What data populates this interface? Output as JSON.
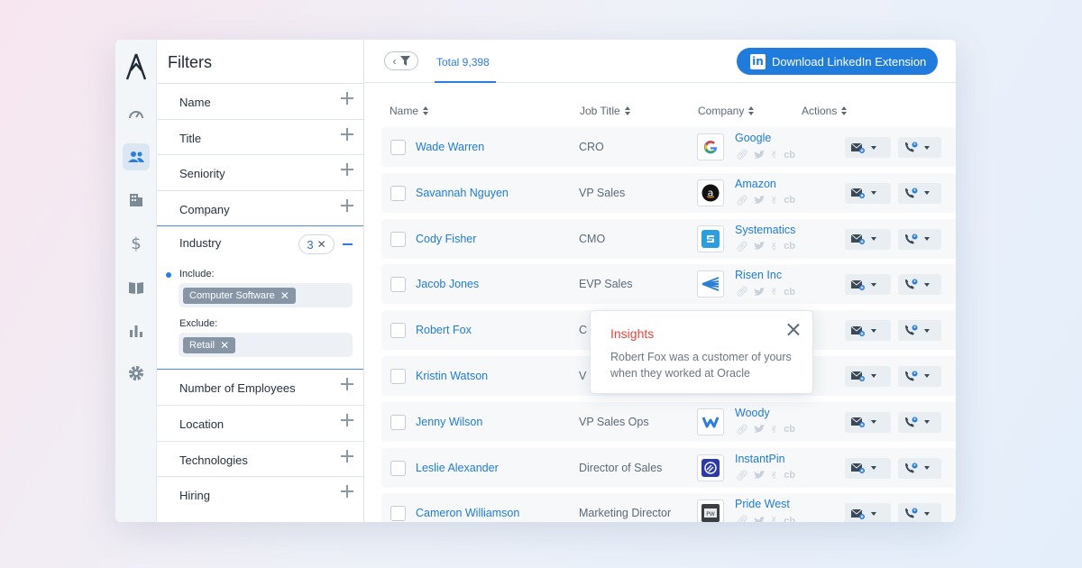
{
  "filters": {
    "title": "Filters",
    "items_top": [
      "Name",
      "Title",
      "Seniority",
      "Company"
    ],
    "industry": {
      "label": "Industry",
      "count": "3",
      "include_label": "Include:",
      "include_tag": "Computer Software",
      "exclude_label": "Exclude:",
      "exclude_tag": "Retail"
    },
    "items_bottom": [
      "Number of Employees",
      "Location",
      "Technologies",
      "Hiring"
    ]
  },
  "topbar": {
    "total": "Total 9,398",
    "download_label": "Download LinkedIn Extension",
    "linkedin_glyph": "in"
  },
  "table": {
    "headers": [
      "Name",
      "Job Title",
      "Company",
      "Actions"
    ],
    "rows": [
      {
        "name": "Wade Warren",
        "title": "CRO",
        "company": "Google",
        "logo": "google"
      },
      {
        "name": "Savannah Nguyen",
        "title": "VP Sales",
        "company": "Amazon",
        "logo": "amazon"
      },
      {
        "name": "Cody Fisher",
        "title": "CMO",
        "company": "Systematics",
        "logo": "systematics"
      },
      {
        "name": "Jacob Jones",
        "title": "EVP Sales",
        "company": "Risen Inc",
        "logo": "risen"
      },
      {
        "name": "Robert Fox",
        "title": "C",
        "company": "",
        "logo": ""
      },
      {
        "name": "Kristin Watson",
        "title": "V",
        "company": "",
        "logo": ""
      },
      {
        "name": "Jenny Wilson",
        "title": "VP Sales Ops",
        "company": "Woody",
        "logo": "woody"
      },
      {
        "name": "Leslie Alexander",
        "title": "Director of Sales",
        "company": "InstantPin",
        "logo": "instantpin"
      },
      {
        "name": "Cameron Williamson",
        "title": "Marketing Director",
        "company": "Pride West",
        "logo": "pridewest"
      }
    ]
  },
  "insights": {
    "title": "Insights",
    "body": "Robert Fox was a customer of yours when they worked at Oracle"
  },
  "colors": {
    "accent": "#1f7bdc",
    "insight_title": "#e8453c"
  }
}
